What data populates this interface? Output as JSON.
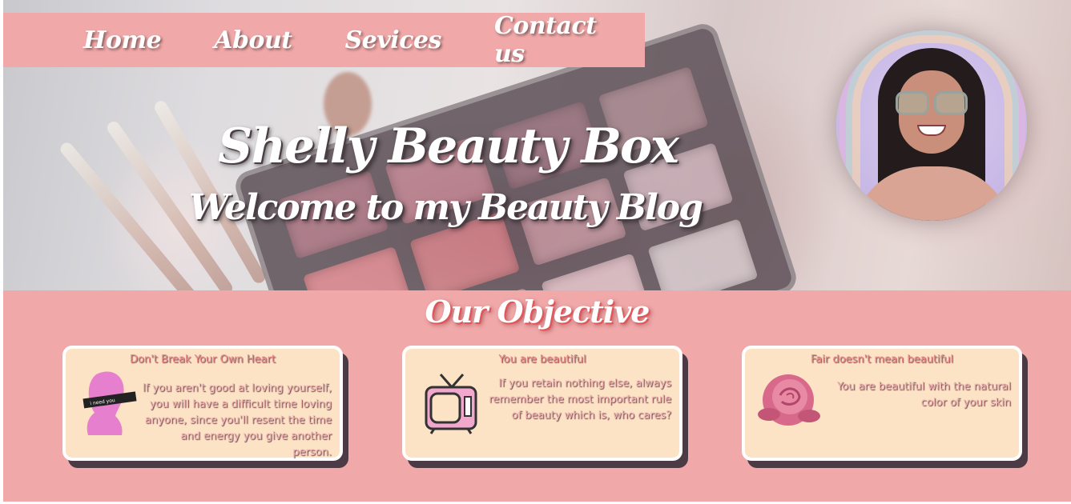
{
  "nav": {
    "items": [
      {
        "label": "Home"
      },
      {
        "label": "About"
      },
      {
        "label": "Sevices"
      },
      {
        "label": "Contact us"
      }
    ]
  },
  "hero": {
    "title": "Shelly Beauty Box",
    "subtitle": "Welcome to my Beauty Blog"
  },
  "objective": {
    "title": "Our Objective",
    "cards": [
      {
        "heading": "Don't Break Your Own Heart",
        "body": "If you aren't good at loving yourself, you will have a difficult time loving anyone, since you'll resent the time and energy you give another person.",
        "image": "statue-icon",
        "image_caption": "i need you"
      },
      {
        "heading": "You are beautiful",
        "body": "If you retain nothing else, always remember the most important rule of beauty which is, who cares?",
        "image": "tv-icon"
      },
      {
        "heading": "Fair doesn't mean beautiful",
        "body": "You are beautiful with the natural color of your skin",
        "image": "rose-icon"
      }
    ]
  },
  "colors": {
    "brand_pink": "#f0a8a8",
    "card_bg": "#fde3c5",
    "card_shadow": "#4c3a45",
    "title_shadow": "#e25558"
  }
}
